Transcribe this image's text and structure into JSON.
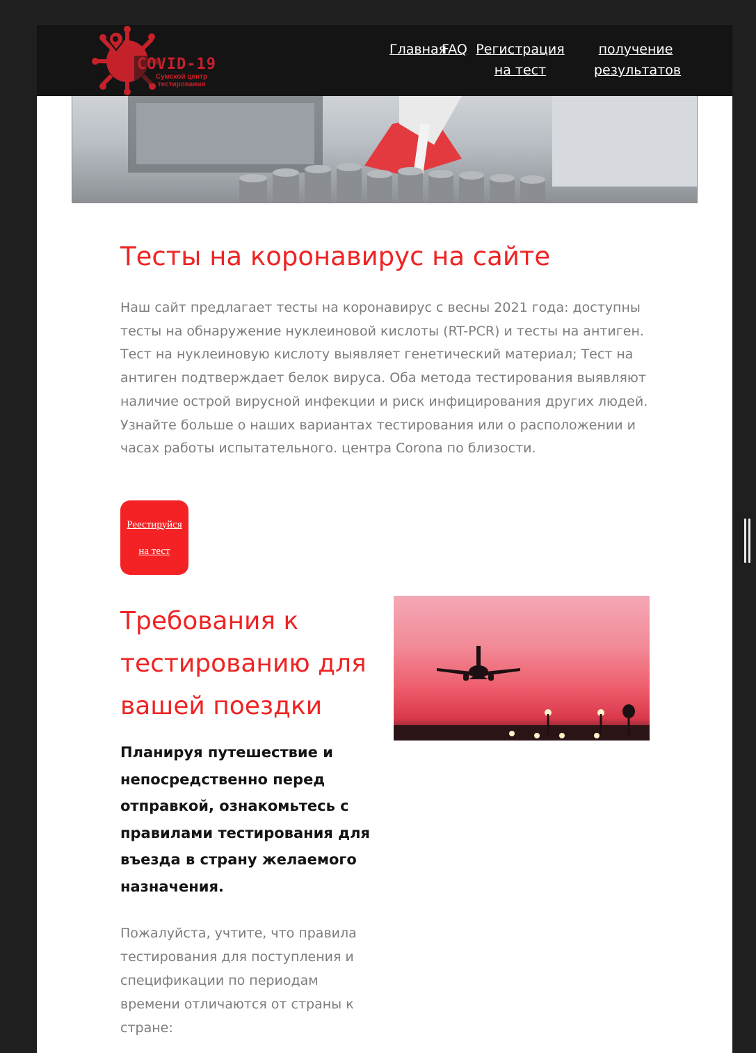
{
  "header": {
    "logo": {
      "title": "COVID-19",
      "subtitle_line1": "Сумской центр",
      "subtitle_line2": "тестирования"
    },
    "nav": {
      "home": "Главная",
      "faq": "FAQ",
      "registration": "Регистрация на тест",
      "results": "получение результатов"
    }
  },
  "main": {
    "heading": "Тесты на коронавирус на сайте",
    "intro": "Наш сайт предлагает тесты на коронавирус с весны 2021 года: доступны тесты на обнаружение нуклеиновой кислоты (RT-PCR) и тесты на антиген. Тест на нуклеиновую кислоту выявляет генетический материал; Тест на антиген подтверждает белок вируса. Оба метода тестирования выявляют наличие острой вирусной инфекции и риск инфицирования других людей. Узнайте больше о наших вариантах тестирования или о расположении и часах работы испытательного. центра Corona по близости.",
    "register_button": "Реестируйся на тест"
  },
  "travel": {
    "heading": "Требования к тестированию для вашей поездки",
    "lead": "Планируя путешествие и непосредственно перед отправкой, ознакомьтесь с правилами тестирования для въезда в страну желаемого назначения.",
    "note": "Пожалуйста, учтите, что правила тестирования для поступления и спецификации по периодам времени отличаются от страны к стране:"
  },
  "colors": {
    "accent": "#ee2424",
    "header_bg": "#141414",
    "button_bg": "#f42224",
    "body_text": "#7d7d7d"
  }
}
